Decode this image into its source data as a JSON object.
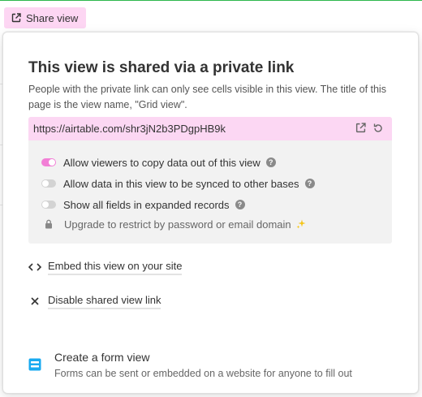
{
  "share_button": {
    "label": "Share view"
  },
  "popover": {
    "title": "This view is shared via a private link",
    "description": "People with the private link can only see cells visible in this view. The title of this page is the view name, \"Grid view\".",
    "url": "https://airtable.com/shr3jN2b3PDgpHB9k",
    "options": [
      {
        "label": "Allow viewers to copy data out of this view",
        "enabled": true,
        "help": true
      },
      {
        "label": "Allow data in this view to be synced to other bases",
        "enabled": false,
        "help": true
      },
      {
        "label": "Show all fields in expanded records",
        "enabled": false,
        "help": true
      }
    ],
    "upgrade_text": "Upgrade to restrict by password or email domain",
    "embed_label": "Embed this view on your site",
    "disable_label": "Disable shared view link",
    "form": {
      "title": "Create a form view",
      "description": "Forms can be sent or embedded on a website for anyone to fill out"
    }
  },
  "colors": {
    "accent_pink": "#fcd7f3",
    "toggle_on": "#f27fd6",
    "form_icon": "#18aaf0"
  },
  "icons": [
    "open-external-icon",
    "open-link-icon",
    "regenerate-icon",
    "help-icon",
    "lock-icon",
    "sparkle-icon",
    "code-icon",
    "close-icon",
    "form-view-icon"
  ]
}
